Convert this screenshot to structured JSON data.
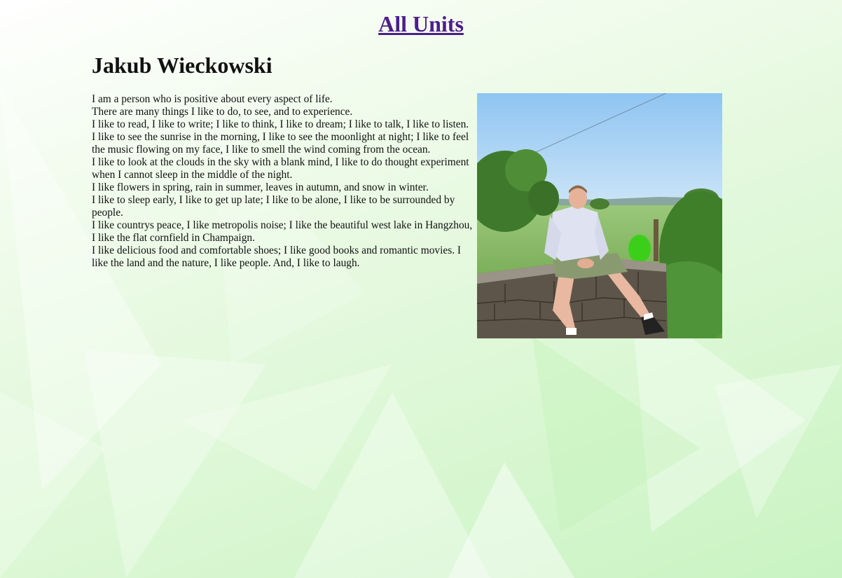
{
  "nav": {
    "all_units_label": "All Units"
  },
  "profile": {
    "name": "Jakub Wieckowski",
    "bio_lines": [
      "I am a person who is positive about every aspect of life.",
      "There are many things I like to do, to see, and to experience.",
      "I like to read, I like to write; I like to think, I like to dream; I like to talk, I like to listen.",
      "I like to see the sunrise in the morning, I like to see the moonlight at night; I like to feel the music flowing on my face, I like to smell the wind coming from the ocean.",
      "I like to look at the clouds in the sky with a blank mind, I like to do thought experiment when I cannot sleep in the middle of the night.",
      "I like flowers in spring, rain in summer, leaves in autumn, and snow in winter.",
      "I like to sleep early, I like to get up late; I like to be alone, I like to be surrounded by people.",
      "I like countrys peace, I like metropolis noise; I like the beautiful west lake in Hangzhou, I like the flat cornfield in Champaign.",
      "I like delicious food and comfortable shoes; I like good books and romantic movies. I like the land and the nature, I like people. And, I like to laugh."
    ]
  },
  "colors": {
    "link": "#4b1f8a",
    "background_light": "#ffffff",
    "background_green": "#c9f3c2"
  }
}
